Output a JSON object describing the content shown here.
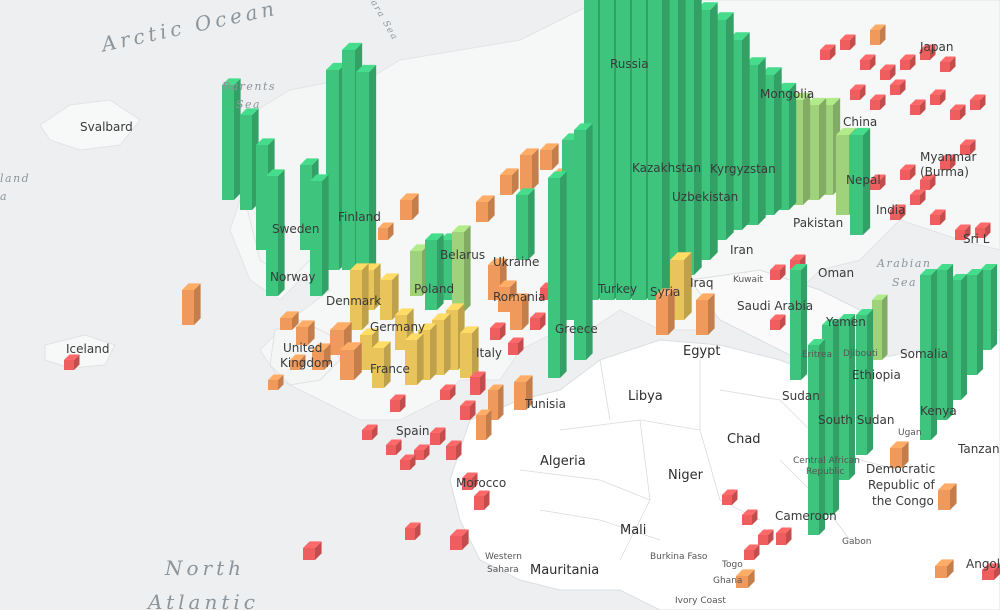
{
  "map": {
    "labels": {
      "oceans": [
        {
          "id": "arctic-ocean",
          "text": "Arctic Ocean"
        },
        {
          "id": "north-atlantic",
          "text": "North"
        },
        {
          "id": "north-atlantic-2",
          "text": "Atlantic"
        }
      ],
      "seas": [
        {
          "id": "barents-sea-1",
          "text": "Barents"
        },
        {
          "id": "barents-sea-2",
          "text": "Sea"
        },
        {
          "id": "kara-sea",
          "text": "Kara Sea"
        },
        {
          "id": "arabian-sea-1",
          "text": "Arabian"
        },
        {
          "id": "arabian-sea-2",
          "text": "Sea"
        },
        {
          "id": "greenland-sea",
          "text": "land"
        },
        {
          "id": "greenland-sea-2",
          "text": "a"
        }
      ],
      "countries": {
        "svalbard": "Svalbard",
        "iceland": "Iceland",
        "sweden": "Sweden",
        "finland": "Finland",
        "norway": "Norway",
        "denmark": "Denmark",
        "belarus": "Belarus",
        "poland": "Poland",
        "ukraine": "Ukraine",
        "romania": "Romania",
        "germany": "Germany",
        "united": "United",
        "kingdom": "Kingdom",
        "france": "France",
        "italy": "Italy",
        "spain": "Spain",
        "greece": "Greece",
        "turkey": "Turkey",
        "syria": "Syria",
        "iraq": "Iraq",
        "iran": "Iran",
        "kuwait": "Kuwait",
        "saudi_arabia": "Saudi Arabia",
        "russia": "Russia",
        "kazakhstan": "Kazakhstan",
        "uzbekistan": "Uzbekistan",
        "kyrgyzstan": "Kyrgyzstan",
        "mongolia": "Mongolia",
        "china": "China",
        "japan": "Japan",
        "myanmar": "Myanmar",
        "burma": "(Burma)",
        "nepal": "Nepal",
        "india": "India",
        "pakistan": "Pakistan",
        "oman": "Oman",
        "yemen": "Yemen",
        "eritrea": "Eritrea",
        "djibouti": "Djibouti",
        "somalia": "Somalia",
        "ethiopia": "Ethiopia",
        "egypt": "Egypt",
        "libya": "Libya",
        "tunisia": "Tunisia",
        "algeria": "Algeria",
        "morocco": "Morocco",
        "western": "Western",
        "sahara": "Sahara",
        "mauritania": "Mauritania",
        "mali": "Mali",
        "niger": "Niger",
        "chad": "Chad",
        "sudan": "Sudan",
        "south_sudan": "South Sudan",
        "kenya": "Kenya",
        "uganda": "Ugan",
        "car_1": "Central African",
        "car_2": "Republic",
        "drc_1": "Democratic",
        "drc_2": "Republic of",
        "drc_3": "the Congo",
        "tanzania": "Tanzan",
        "cameroon": "Cameroon",
        "gabon": "Gabon",
        "burkina": "Burkina Faso",
        "togo": "Togo",
        "ghana": "Ghana",
        "ivory": "Ivory Coast",
        "angola": "Angol",
        "sri_lanka": "Sri L"
      }
    },
    "colors": {
      "high": "#3ec47c",
      "high_mid": "#9fd27a",
      "mid": "#e8c45a",
      "low_mid": "#ef9a5c",
      "low": "#ee5e5e",
      "land": "#f7f8f8",
      "water": "#edeff0",
      "africa_land": "#ffffff"
    }
  }
}
